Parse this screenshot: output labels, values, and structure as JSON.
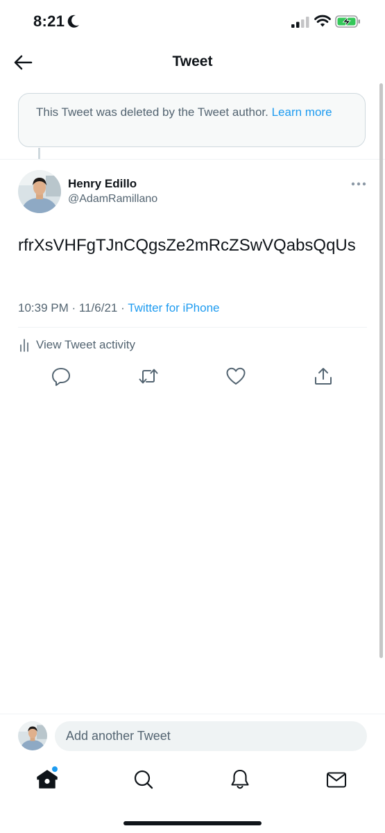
{
  "status_bar": {
    "time": "8:21"
  },
  "header": {
    "title": "Tweet"
  },
  "notice": {
    "text": "This Tweet was deleted by the Tweet author.",
    "link": "Learn more"
  },
  "tweet": {
    "author_name": "Henry Edillo",
    "author_handle": "@AdamRamillano",
    "text": "rfrXsVHFgTJnCQgsZe2mRcZSwVQabsQqUs",
    "time": "10:39 PM",
    "separator": "·",
    "date": "11/6/21",
    "source": "Twitter for iPhone",
    "activity_label": "View Tweet activity"
  },
  "compose": {
    "placeholder": "Add another Tweet"
  },
  "icons": {
    "back": "arrow-left-icon",
    "more": "more-icon",
    "reply": "reply-icon",
    "retweet": "retweet-icon",
    "like": "heart-icon",
    "share": "share-icon",
    "home": "home-icon",
    "search": "search-icon",
    "notifications": "bell-icon",
    "messages": "mail-icon"
  },
  "colors": {
    "accent": "#1d9bf0",
    "text": "#0f1419",
    "secondary": "#536471"
  }
}
